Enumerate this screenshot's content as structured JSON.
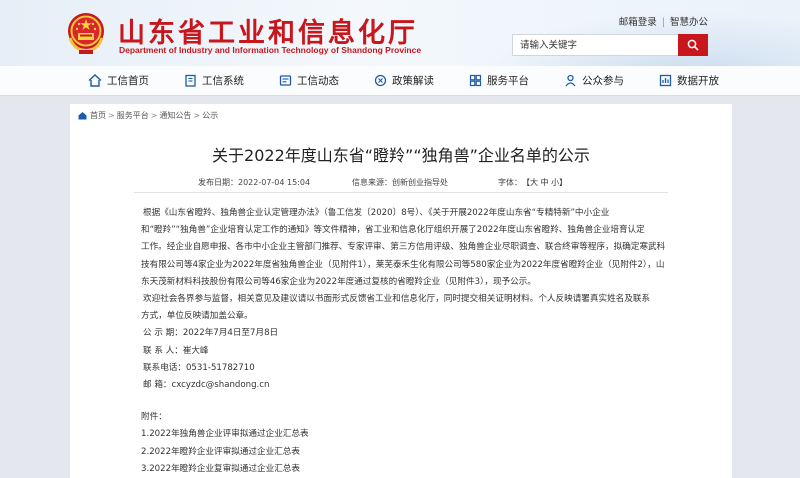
{
  "header": {
    "title": "山东省工业和信息化厅",
    "subtitle": "Department of Industry and Information Technology of Shandong Province",
    "links": [
      "邮箱登录",
      "智慧办公"
    ],
    "search_placeholder": "请输入关键字"
  },
  "nav": {
    "items": [
      {
        "label": "工信首页",
        "icon": "home-icon"
      },
      {
        "label": "工信系统",
        "icon": "building-icon"
      },
      {
        "label": "工信动态",
        "icon": "news-icon"
      },
      {
        "label": "政策解读",
        "icon": "policy-icon"
      },
      {
        "label": "服务平台",
        "icon": "service-icon"
      },
      {
        "label": "公众参与",
        "icon": "people-icon"
      },
      {
        "label": "数据开放",
        "icon": "data-icon"
      }
    ]
  },
  "breadcrumb": [
    "首页",
    "服务平台",
    "通知公告",
    "公示"
  ],
  "article": {
    "title": "关于2022年度山东省“瞪羚”“独角兽”企业名单的公示",
    "published_label": "发布日期：2022-07-04 15:04",
    "source_label": "信息来源：创新创业指导处",
    "font_label": "字体：",
    "font_sizes": "【大 中 小】",
    "p1_lines": [
      "根据《山东省瞪羚、独角兽企业认定管理办法》（鲁工信发〔2020〕8号）、《关于开展2022年度山东省“专精特新”中小企业",
      "和“瞪羚”“独角兽”企业培育认定工作的通知》等文件精神，省工业和信息化厅组织开展了2022年度山东省瞪羚、独角兽企业培育认定",
      "工作。经企业自愿申报、各市中小企业主管部门推荐、专家评审、第三方信用评级、独角兽企业尽职调查、联合终审等程序，拟确定寒武科",
      "技有限公司等4家企业为2022年度省独角兽企业（见附件1），莱芜泰禾生化有限公司等580家企业为2022年度省瞪羚企业（见附件2），山",
      "东天茂新材料科技股份有限公司等46家企业为2022年度通过复核的省瞪羚企业（见附件3），现予公示。"
    ],
    "p2_lines": [
      "欢迎社会各界参与监督，相关意见及建议请以书面形式反馈省工业和信息化厅，同时提交相关证明材料。个人反映请署真实姓名及联系",
      "方式，单位反映请加盖公章。"
    ],
    "period": "公 示 期：2022年7月4日至7月8日",
    "contact": "联 系 人：崔大峰",
    "phone": "联系电话：0531-51782710",
    "email": "邮    箱：cxcyzdc@shandong.cn",
    "attachments_label": "附件：",
    "attachments": [
      "1.2022年独角兽企业评审拟通过企业汇总表",
      "2.2022年瞪羚企业评审拟通过企业汇总表",
      "3.2022年瞪羚企业复审拟通过企业汇总表"
    ]
  }
}
